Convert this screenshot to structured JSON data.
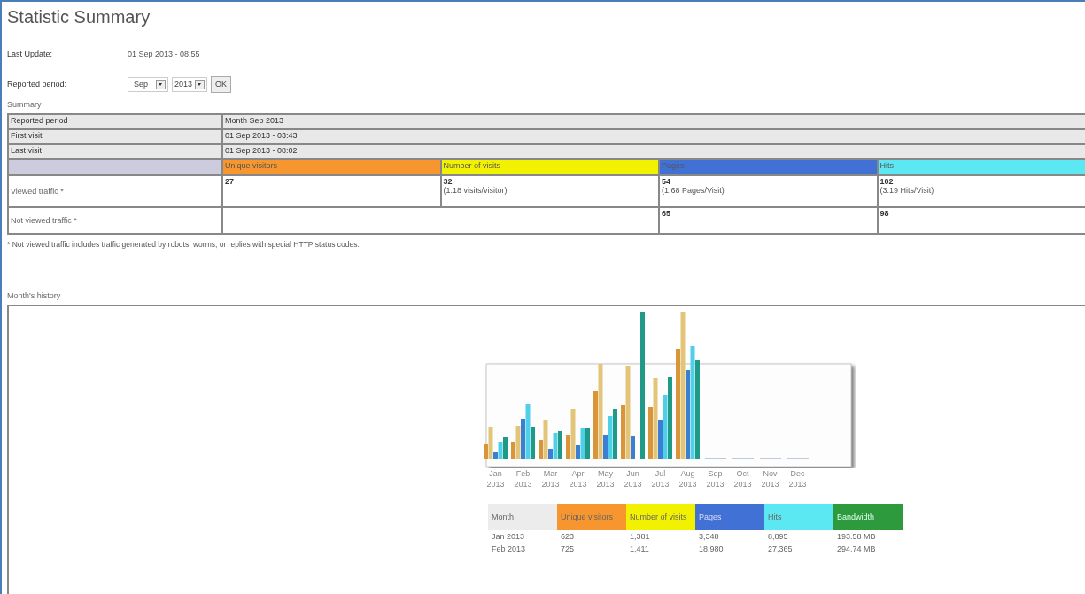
{
  "title": "Statistic Summary",
  "last_update": {
    "label": "Last Update:",
    "value": "01 Sep 2013 - 08:55"
  },
  "reported_period": {
    "label": "Reported period:",
    "month": "Sep",
    "year": "2013",
    "button": "OK"
  },
  "summary": {
    "heading": "Summary",
    "info_rows": [
      {
        "label": "Reported period",
        "value": "Month Sep 2013"
      },
      {
        "label": "First visit",
        "value": "01 Sep 2013 - 03:43"
      },
      {
        "label": "Last visit",
        "value": "01 Sep 2013 - 08:02"
      }
    ],
    "columns": [
      {
        "label": "Unique visitors",
        "color": "#f7962e"
      },
      {
        "label": "Number of visits",
        "color": "#f2f200"
      },
      {
        "label": "Pages",
        "color": "#4271d6"
      },
      {
        "label": "Hits",
        "color": "#5ce8f2"
      }
    ],
    "rows": [
      {
        "label": "Viewed traffic *",
        "cells": [
          {
            "value": "27"
          },
          {
            "value": "32",
            "note": "(1.18 visits/visitor)"
          },
          {
            "value": "54",
            "note": "(1.68 Pages/Visit)"
          },
          {
            "value": "102",
            "note": "(3.19 Hits/Visit)"
          }
        ]
      },
      {
        "label": "Not viewed traffic *",
        "cells": [
          {},
          {},
          {
            "value": "65"
          },
          {
            "value": "98"
          }
        ]
      }
    ],
    "footnote": "* Not viewed traffic includes traffic generated by robots, worms, or replies with special HTTP status codes."
  },
  "history": {
    "heading": "Month's history",
    "months": [
      {
        "month": "Jan",
        "year": "2013"
      },
      {
        "month": "Feb",
        "year": "2013"
      },
      {
        "month": "Mar",
        "year": "2013"
      },
      {
        "month": "Apr",
        "year": "2013"
      },
      {
        "month": "May",
        "year": "2013"
      },
      {
        "month": "Jun",
        "year": "2013"
      },
      {
        "month": "Jul",
        "year": "2013"
      },
      {
        "month": "Aug",
        "year": "2013"
      },
      {
        "month": "Sep",
        "year": "2013"
      },
      {
        "month": "Oct",
        "year": "2013"
      },
      {
        "month": "Nov",
        "year": "2013"
      },
      {
        "month": "Dec",
        "year": "2013"
      }
    ],
    "table": {
      "columns": [
        {
          "label": "Month",
          "color": "#ececec"
        },
        {
          "label": "Unique visitors",
          "color": "#f7962e"
        },
        {
          "label": "Number of visits",
          "color": "#f2f200"
        },
        {
          "label": "Pages",
          "color": "#4271d6"
        },
        {
          "label": "Hits",
          "color": "#5ce8f2"
        },
        {
          "label": "Bandwidth",
          "color": "#2e9a3e"
        }
      ],
      "rows": [
        [
          "Jan 2013",
          "623",
          "1,381",
          "3,348",
          "8,895",
          "193.58 MB"
        ],
        [
          "Feb 2013",
          "725",
          "1,411",
          "18,980",
          "27,365",
          "294.74 MB"
        ]
      ]
    }
  }
}
